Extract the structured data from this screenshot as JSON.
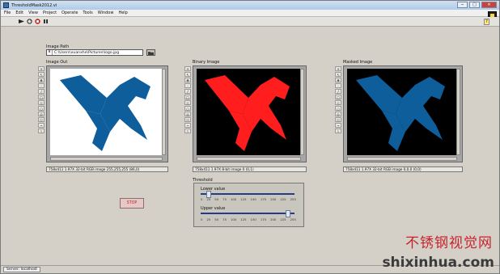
{
  "window": {
    "title": "ThresholdMask2012.vi",
    "min": "−",
    "max": "□",
    "close": "✕"
  },
  "menu": [
    "File",
    "Edit",
    "View",
    "Project",
    "Operate",
    "Tools",
    "Window",
    "Help"
  ],
  "toolbar": [
    "run-arrow-icon",
    "run-continuously-icon",
    "abort-icon",
    "pause-icon"
  ],
  "image_path": {
    "label": "Image Path",
    "prefix": "8",
    "value": "C:\\Users\\xuanxhe\\Pictures\\logo.jpg"
  },
  "images": [
    {
      "label": "Image Out",
      "status": "758x411 1.97X 32-bit RGB image 255,255,255   (86,0)",
      "bg": "#ffffff",
      "fg": "#0f5e9c"
    },
    {
      "label": "Binary Image",
      "status": "758x411 1.97X 8-bit image 0   (0,1)",
      "bg": "#000000",
      "fg": "#ff1d1d"
    },
    {
      "label": "Masked Image",
      "status": "758x411 1.97X 32-bit RGB image 0,0,0   (0,0)",
      "bg": "#000000",
      "fg": "#0f5e9c"
    }
  ],
  "stop_button": "STOP",
  "threshold": {
    "label": "Threshold",
    "lower": {
      "label": "Lower value",
      "value": 14
    },
    "upper": {
      "label": "Upper value",
      "value": 240
    },
    "ticks": [
      "0",
      "25",
      "50",
      "75",
      "100",
      "125",
      "150",
      "175",
      "200",
      "225",
      "255"
    ]
  },
  "statusbar": {
    "server": "Server: localhost"
  },
  "watermark": {
    "cn": "不锈钢视觉网",
    "en": "shixinhua.com"
  }
}
